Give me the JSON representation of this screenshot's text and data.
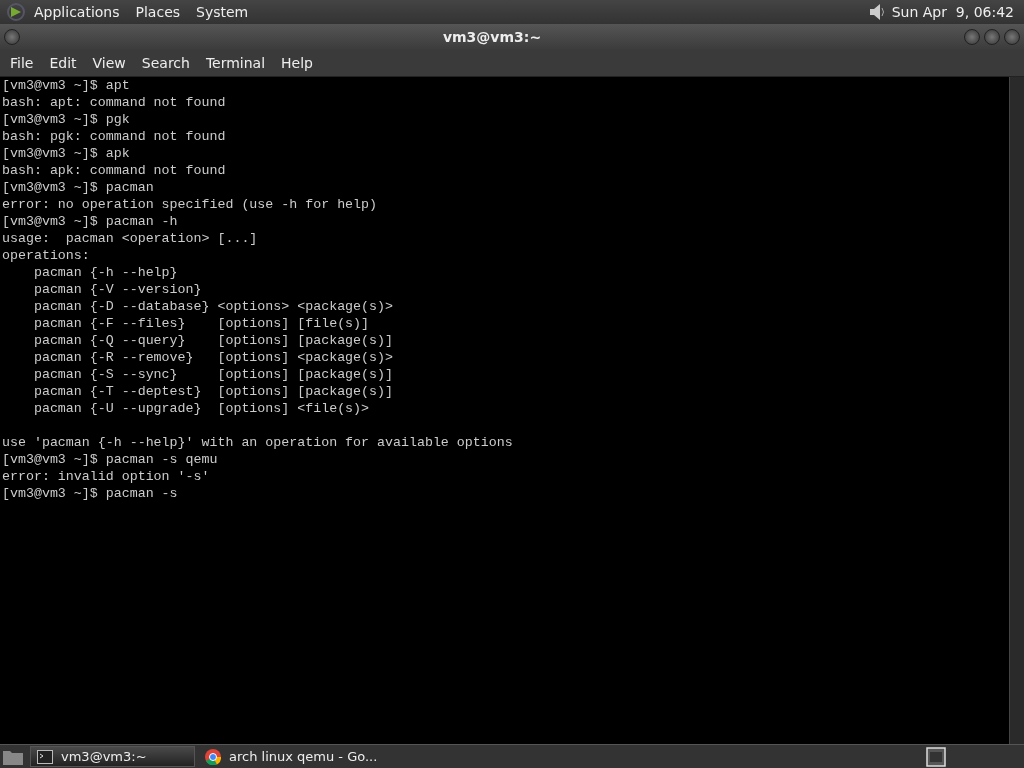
{
  "top_panel": {
    "menus": [
      "Applications",
      "Places",
      "System"
    ],
    "clock": "Sun Apr  9, 06:42"
  },
  "window": {
    "title": "vm3@vm3:~"
  },
  "menu_bar": [
    "File",
    "Edit",
    "View",
    "Search",
    "Terminal",
    "Help"
  ],
  "terminal": {
    "lines": [
      {
        "text": "[vm3@vm3 ~]$ apt"
      },
      {
        "text": "bash: apt: command not found"
      },
      {
        "text": "[vm3@vm3 ~]$ pgk"
      },
      {
        "text": "bash: pgk: command not found"
      },
      {
        "text": "[vm3@vm3 ~]$ apk"
      },
      {
        "text": "bash: apk: command not found"
      },
      {
        "text": "[vm3@vm3 ~]$ pacman"
      },
      {
        "text": "error: no operation specified (use -h for help)"
      },
      {
        "text": "[vm3@vm3 ~]$ pacman -h"
      },
      {
        "text": "usage:  pacman <operation> [...]"
      },
      {
        "text": "operations:"
      },
      {
        "text": "    pacman {-h --help}"
      },
      {
        "text": "    pacman {-V --version}"
      },
      {
        "text": "    pacman {-D --database} <options> <package(s)>"
      },
      {
        "text": "    pacman {-F --files}    [options] [file(s)]"
      },
      {
        "text": "    pacman {-Q --query}    [options] [package(s)]"
      },
      {
        "text": "    pacman {-R --remove}   [options] <package(s)>"
      },
      {
        "text": "    pacman {-S --sync}     [options] [package(s)]"
      },
      {
        "text": "    pacman {-T --deptest}  [options] [package(s)]"
      },
      {
        "text": "    pacman {-U --upgrade}  [options] <file(s)>"
      },
      {
        "text": "use 'pacman {-h --help}' with an operation for available options",
        "gap_before": true
      },
      {
        "text": "[vm3@vm3 ~]$ pacman -s qemu"
      },
      {
        "text": "error: invalid option '-s'"
      },
      {
        "text": "[vm3@vm3 ~]$ pacman -s"
      }
    ]
  },
  "taskbar": {
    "tasks": [
      {
        "label": "vm3@vm3:~",
        "kind": "terminal",
        "selected": true
      },
      {
        "label": "arch linux qemu - Go...",
        "kind": "browser",
        "selected": false
      }
    ]
  }
}
